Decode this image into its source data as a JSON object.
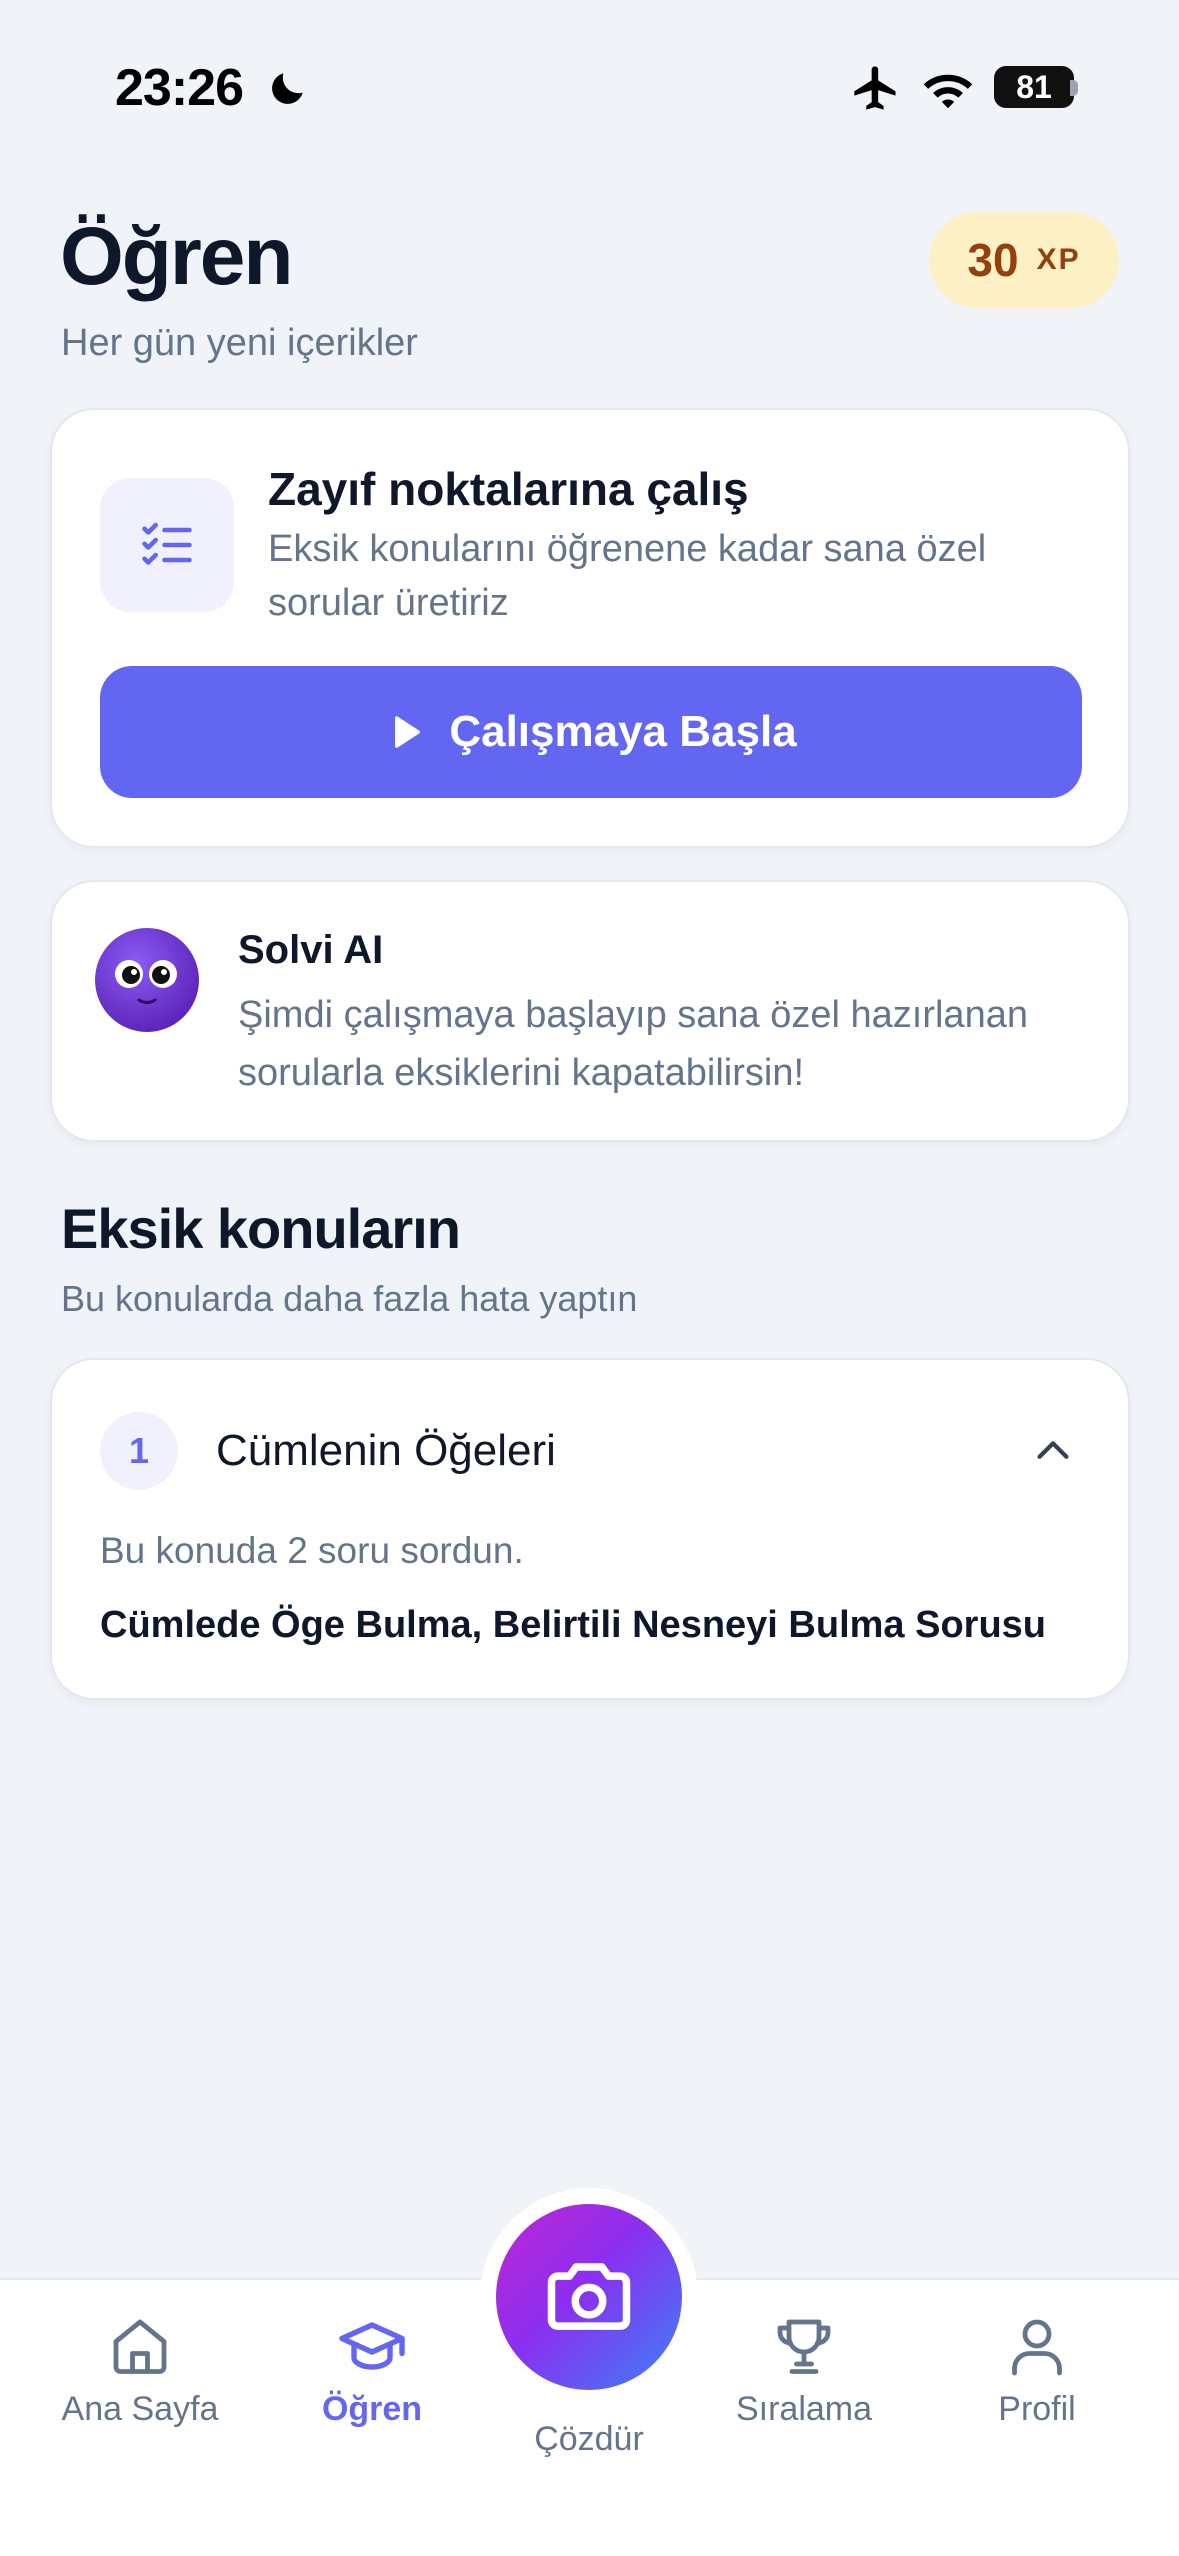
{
  "status_bar": {
    "time": "23:26",
    "battery": "81",
    "icons": [
      "moon-icon",
      "airplane-icon",
      "wifi-icon",
      "battery-icon"
    ]
  },
  "header": {
    "title": "Öğren",
    "subtitle": "Her gün yeni içerikler",
    "xp_value": "30",
    "xp_unit": "XP"
  },
  "practice_card": {
    "icon": "checklist-icon",
    "title": "Zayıf noktalarına çalış",
    "description": "Eksik konularını öğrenene kadar sana özel sorular üretiriz",
    "button_label": "Çalışmaya Başla",
    "button_icon": "play-icon"
  },
  "ai_card": {
    "avatar": "solvi-avatar",
    "name": "Solvi AI",
    "message": "Şimdi çalışmaya başlayıp sana özel hazırlanan sorularla eksiklerini kapatabilirsin!"
  },
  "weak_topics": {
    "title": "Eksik konuların",
    "subtitle": "Bu konularda daha fazla hata yaptın",
    "items": [
      {
        "number": "1",
        "title": "Cümlenin Öğeleri",
        "expanded": true,
        "count_text": "Bu konuda 2 soru sordun.",
        "subtopics": "Cümlede Öge Bulma, Belirtili Nesneyi Bulma Sorusu"
      }
    ]
  },
  "bottom_nav": {
    "items": [
      {
        "label": "Ana Sayfa",
        "icon": "home-icon",
        "active": false
      },
      {
        "label": "Öğren",
        "icon": "graduation-cap-icon",
        "active": true
      },
      {
        "label": "Çözdür",
        "icon": "camera-icon",
        "active": false
      },
      {
        "label": "Sıralama",
        "icon": "trophy-icon",
        "active": false
      },
      {
        "label": "Profil",
        "icon": "user-icon",
        "active": false
      }
    ]
  },
  "colors": {
    "accent": "#6366f1",
    "background": "#f0f3f8",
    "xp_badge_bg": "#fdf0c4",
    "xp_text": "#92400e",
    "muted_text": "#64748b"
  }
}
